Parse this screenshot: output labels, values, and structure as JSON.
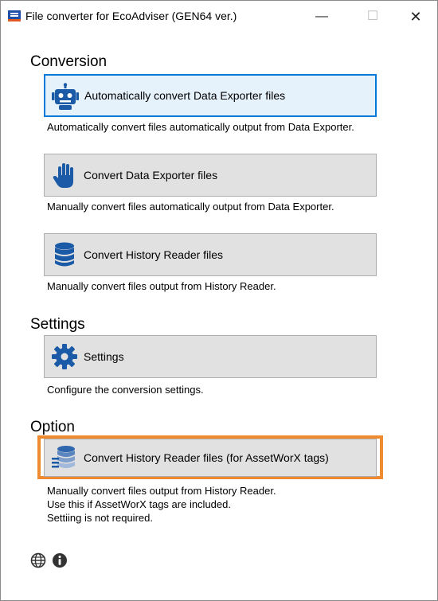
{
  "window": {
    "title": "File converter for EcoAdviser (GEN64 ver.)",
    "controls": {
      "minimize": "—",
      "maximize": "☐",
      "close": "✕"
    }
  },
  "conversion": {
    "heading": "Conversion",
    "auto_button": {
      "label": "Automatically convert Data Exporter files",
      "icon": "robot-icon"
    },
    "auto_desc": "Automatically convert files automatically output from Data Exporter.",
    "manual_button": {
      "label": "Convert Data Exporter files",
      "icon": "hand-icon"
    },
    "manual_desc": "Manually convert files automatically output from Data Exporter.",
    "history_button": {
      "label": "Convert History Reader files",
      "icon": "database-icon"
    },
    "history_desc": "Manually convert files output from History Reader."
  },
  "settings": {
    "heading": "Settings",
    "button": {
      "label": "Settings",
      "icon": "gear-icon"
    },
    "desc": "Configure the conversion settings."
  },
  "option": {
    "heading": "Option",
    "button": {
      "label": "Convert History Reader files (for AssetWorX tags)",
      "icon": "database-tags-icon"
    },
    "desc_lines": [
      "Manually convert files output from History Reader.",
      "Use this if AssetWorX tags are included.",
      "Settiing is not required."
    ]
  },
  "footer": {
    "icons": [
      "globe-icon",
      "info-icon"
    ]
  },
  "colors": {
    "focus_border": "#0078d7",
    "highlight_border": "#ef8a2e",
    "icon_blue": "#1a5aa6"
  }
}
